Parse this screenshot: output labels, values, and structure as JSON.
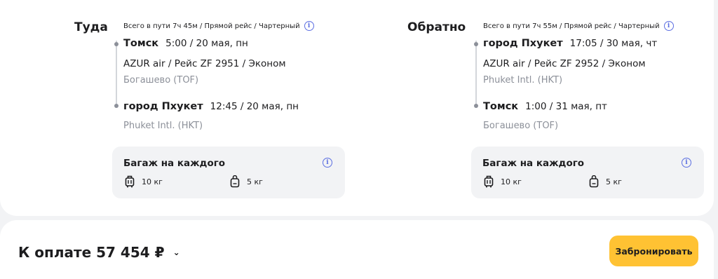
{
  "outbound": {
    "label": "Туда",
    "summary": "Всего в пути 7ч 45м / Прямой рейс / Чартерный",
    "departure": {
      "city": "Томск",
      "time": "5:00 / 20 мая, пн"
    },
    "flight": "AZUR air / Рейс ZF 2951 / Эконом",
    "departure_airport": "Богашево (TOF)",
    "arrival": {
      "city": "город Пхукет",
      "time": "12:45 / 20 мая, пн"
    },
    "arrival_airport": "Phuket Intl. (HKT)",
    "baggage": {
      "title": "Багаж на каждого",
      "luggage": "10 кг",
      "hand": "5 кг"
    }
  },
  "return": {
    "label": "Обратно",
    "summary": "Всего в пути 7ч 55м / Прямой рейс / Чартерный",
    "departure": {
      "city": "город Пхукет",
      "time": "17:05 / 30 мая, чт"
    },
    "flight": "AZUR air / Рейс ZF 2952 / Эконом",
    "departure_airport": "Phuket Intl. (HKT)",
    "arrival": {
      "city": "Томск",
      "time": "1:00 / 31 мая, пт"
    },
    "arrival_airport": "Богашево (TOF)",
    "baggage": {
      "title": "Багаж на каждого",
      "luggage": "10 кг",
      "hand": "5 кг"
    }
  },
  "footer": {
    "total": "К оплате 57 454 ₽",
    "book_button": "Забронировать"
  },
  "colors": {
    "accent": "#ffc233",
    "info": "#5b6ee1",
    "muted": "#8c9099"
  }
}
